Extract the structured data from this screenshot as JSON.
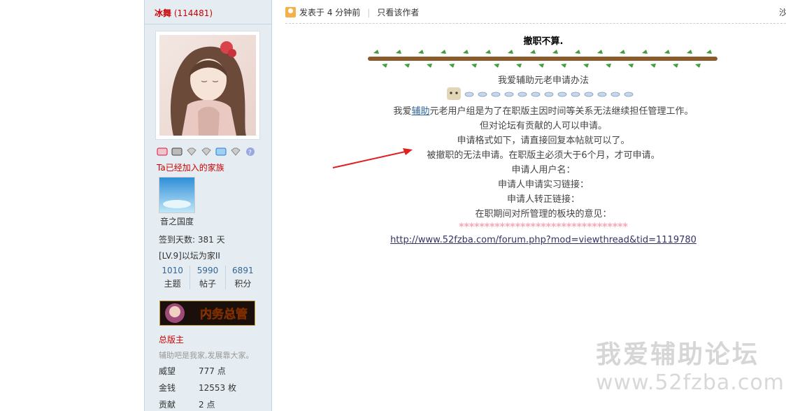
{
  "author": {
    "name": "冰舞",
    "uid": "(114481)"
  },
  "avatar": {
    "icon": "anime-girl-avatar"
  },
  "medals": [
    "medal-1",
    "medal-2",
    "medal-3",
    "medal-4",
    "medal-5",
    "medal-6",
    "medal-7"
  ],
  "family": {
    "link": "Ta已经加入的家族",
    "name": "音之国度"
  },
  "profile": {
    "sign_days": "签到天数: 381 天",
    "level": "[LV.9]以坛为家II",
    "stats": [
      {
        "num": "1010",
        "label": "主题"
      },
      {
        "num": "5990",
        "label": "帖子"
      },
      {
        "num": "6891",
        "label": "积分"
      }
    ],
    "rank_badge": "内务总管",
    "rank": "总版主",
    "motto": "辅助吧是我家,发展靠大家。",
    "info": [
      {
        "key": "威望",
        "value": "777 点"
      },
      {
        "key": "金钱",
        "value": "12553 枚"
      },
      {
        "key": "贡献",
        "value": "2 点"
      }
    ]
  },
  "post": {
    "meta": "发表于 4 分钟前",
    "only_author": "只看该作者",
    "meta_right": "沙",
    "title": "撤职不算.",
    "heading": "我爱辅助元老申请办法",
    "line1_pre": "我爱",
    "line1_link": "辅助",
    "line1_post": "元老用户组是为了在职版主因时间等关系无法继续担任管理工作。",
    "line2": "但对论坛有贡献的人可以申请。",
    "line3": "申请格式如下，请直接回复本帖就可以了。",
    "line4": "被撤职的无法申请。在职版主必须大于6个月，才可申请。",
    "line5": "申请人用户名：",
    "line6": "申请人申请实习链接：",
    "line7": "申请人转正链接：",
    "line8": "在职期间对所管理的板块的意见：",
    "stars": "*********************************",
    "url": "http://www.52fzba.com/forum.php?mod=viewthread&tid=1119780"
  },
  "watermark": {
    "cn": "我爱辅助论坛",
    "url": "www.52fzba.com"
  }
}
